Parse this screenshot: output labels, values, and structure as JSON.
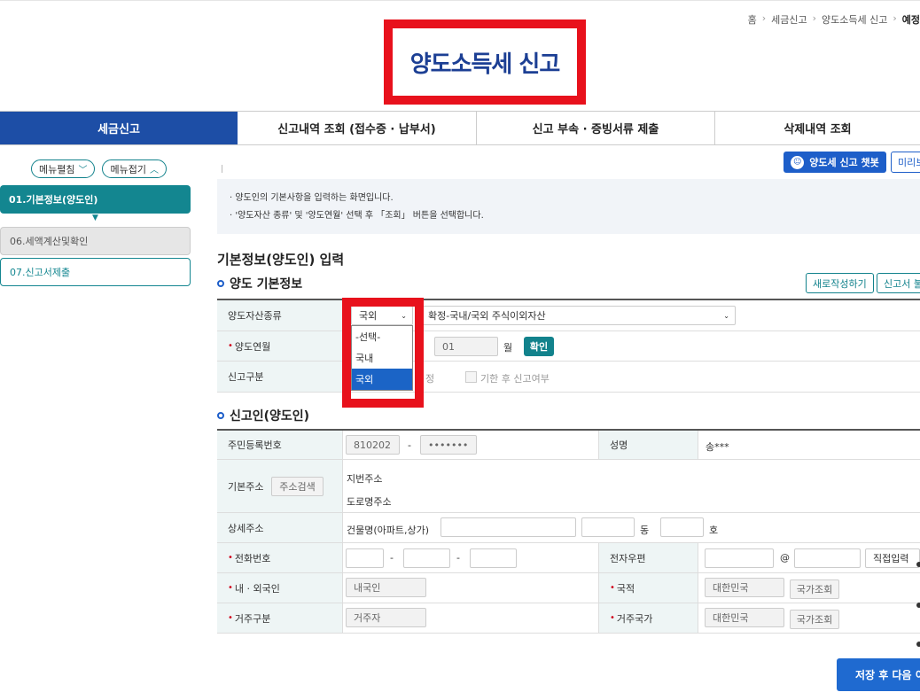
{
  "breadcrumb": [
    "홈",
    "세금신고",
    "양도소득세 신고",
    "예정"
  ],
  "page_title": "양도소득세 신고",
  "tabs": [
    {
      "label": "세금신고"
    },
    {
      "label": "신고내역 조회 (접수증 · 납부서)"
    },
    {
      "label": "신고 부속 · 증빙서류 제출"
    },
    {
      "label": "삭제내역 조회"
    }
  ],
  "sidebar": {
    "expand_label": "메뉴펼침",
    "collapse_label": "메뉴접기",
    "items": [
      {
        "label": "01.기본정보(양도인)"
      },
      {
        "label": "06.세액계산및확인"
      },
      {
        "label": "07.신고서제출"
      }
    ]
  },
  "toolbar": {
    "chatbot_label": "양도세 신고 챗봇",
    "preview_label": "미리보"
  },
  "notice": [
    "· 양도인의 기본사항을 입력하는 화면입니다.",
    "· '양도자산 종류' 및 '양도연월' 선택 후 「조회」 버튼을 선택합니다."
  ],
  "section_title": "기본정보(양도인) 입력",
  "basic": {
    "title": "양도 기본정보",
    "new_button": "새로작성하기",
    "load_button": "신고서 불",
    "asset_type_label": "양도자산종류",
    "asset_select_value": "국외",
    "asset_detail_value": "확정-국내/국외 주식이외자산",
    "period_label": "양도연월",
    "month_value": "01",
    "month_unit": "월",
    "confirm_button": "확인",
    "report_type_label": "신고구분",
    "report_type_partial": "정",
    "late_label": "기한 후 신고여부",
    "dropdown_options": [
      "-선택-",
      "국내",
      "국외"
    ]
  },
  "reporter": {
    "title": "신고인(양도인)",
    "rrn_label": "주민등록번호",
    "rrn_front": "810202",
    "rrn_dash": "-",
    "rrn_back": "•••••••",
    "name_label": "성명",
    "name_value": "송***",
    "address_label": "기본주소",
    "address_search": "주소검색",
    "jibun_label": "지번주소",
    "road_label": "도로명주소",
    "detail_label": "상세주소",
    "building_label": "건물명(아파트,상가)",
    "dong_label": "동",
    "ho_label": "호",
    "phone_label": "전화번호",
    "phone_dash": "-",
    "email_label": "전자우편",
    "email_at": "@",
    "email_direct": "직접입력",
    "nationality_type_label": "내 · 외국인",
    "nationality_type_value": "내국인",
    "nationality_label": "국적",
    "nationality_value": "대한민국",
    "country_search": "국가조회",
    "residence_label": "거주구분",
    "residence_value": "거주자",
    "residence_country_label": "거주국가",
    "residence_country_value": "대한민국"
  },
  "save_button": "저장 후 다음 이",
  "colors": {
    "primary": "#1d4ea6",
    "teal": "#12828c",
    "highlight_red": "#e8111c",
    "title_blue": "#1c3f94"
  }
}
